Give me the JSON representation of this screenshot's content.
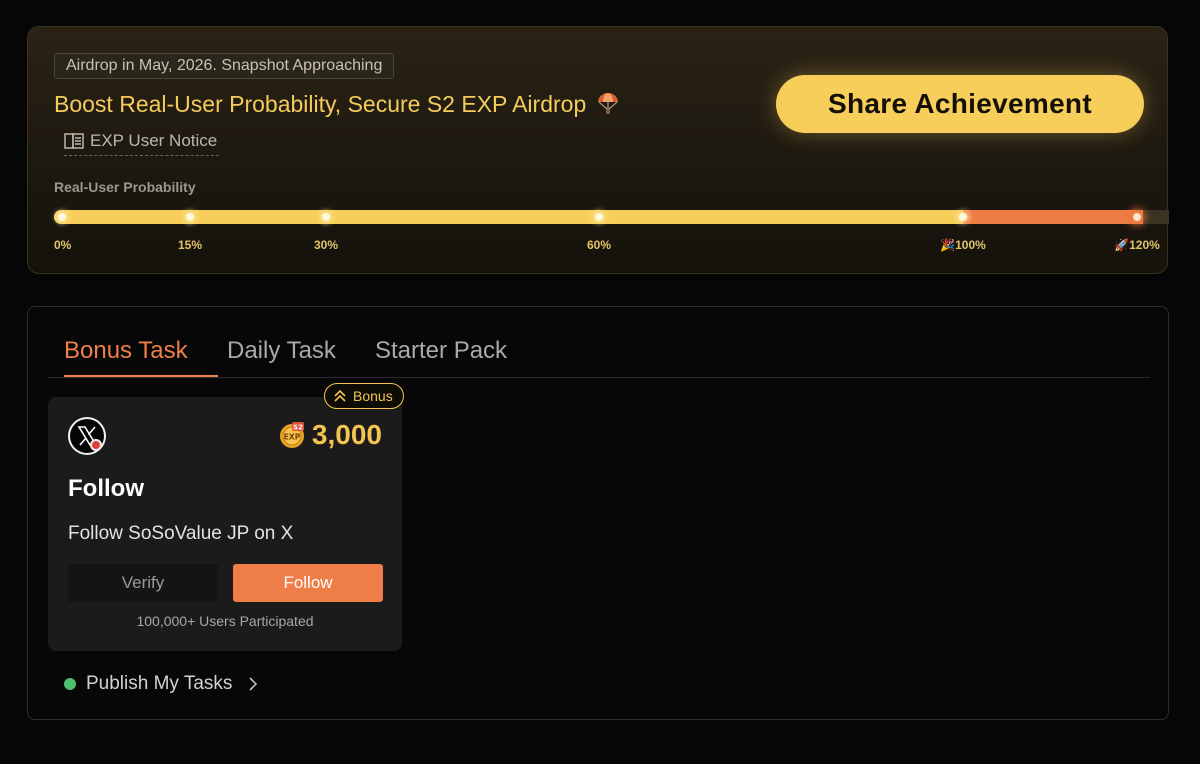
{
  "banner": {
    "snapshot_text": "Airdrop in May, 2026. Snapshot Approaching",
    "headline": "Boost Real-User Probability, Secure S2 EXP Airdrop",
    "headline_icon": "parachute-icon",
    "notice_label": "EXP User Notice",
    "share_label": "Share Achievement",
    "probability_label": "Real-User Probability",
    "progress_percent": 120,
    "progress_max_percent": 120,
    "milestones": [
      {
        "label": "0%",
        "value": 0
      },
      {
        "label": "15%",
        "value": 15
      },
      {
        "label": "30%",
        "value": 30
      },
      {
        "label": "60%",
        "value": 60
      },
      {
        "label": "🎉100%",
        "value": 100
      },
      {
        "label": "🚀120%",
        "value": 120
      }
    ],
    "colors": {
      "accent": "#F7CE5A",
      "overflow": "#EE7C45"
    }
  },
  "tabs": [
    {
      "label": "Bonus Task",
      "active": true
    },
    {
      "label": "Daily Task",
      "active": false
    },
    {
      "label": "Starter Pack",
      "active": false
    }
  ],
  "task_card": {
    "badge": "Bonus",
    "platform_icon": "x-logo-icon",
    "reward_icon": "s2-exp-coin-icon",
    "reward_coin_top": "S2",
    "reward_coin_main": "EXP",
    "reward": "3,000",
    "title": "Follow",
    "description": "Follow SoSoValue JP on X",
    "verify_label": "Verify",
    "follow_label": "Follow",
    "participants": "100,000+ Users Participated"
  },
  "publish": {
    "label": "Publish My Tasks",
    "status_color": "#4FBF6F"
  }
}
